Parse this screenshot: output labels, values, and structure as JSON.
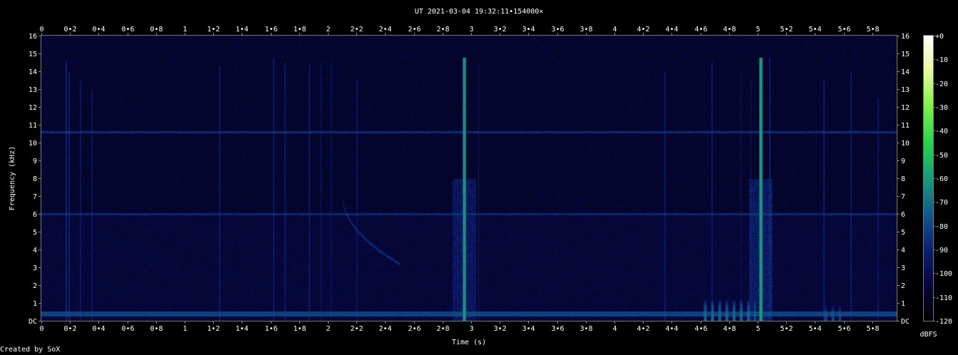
{
  "chart_data": {
    "type": "heatmap",
    "title": "UT 2021-03-04 19:32:11•154000×",
    "xlabel": "Time (s)",
    "ylabel": "Frequency (kHz)",
    "xlim": [
      0,
      5.97
    ],
    "ylim": [
      0,
      16
    ],
    "x_ticks": [
      "0",
      "0•2",
      "0•4",
      "0•6",
      "0•8",
      "1",
      "1•2",
      "1•4",
      "1•6",
      "1•8",
      "2",
      "2•2",
      "2•4",
      "2•6",
      "2•8",
      "3",
      "3•2",
      "3•4",
      "3•6",
      "3•8",
      "4",
      "4•2",
      "4•4",
      "4•6",
      "4•8",
      "5",
      "5•2",
      "5•4",
      "5•6",
      "5•8"
    ],
    "x_tick_values": [
      0,
      0.2,
      0.4,
      0.6,
      0.8,
      1,
      1.2,
      1.4,
      1.6,
      1.8,
      2,
      2.2,
      2.4,
      2.6,
      2.8,
      3,
      3.2,
      3.4,
      3.6,
      3.8,
      4,
      4.2,
      4.4,
      4.6,
      4.8,
      5,
      5.2,
      5.4,
      5.6,
      5.8
    ],
    "y_ticks": [
      "DC",
      "1",
      "2",
      "3",
      "4",
      "5",
      "6",
      "7",
      "8",
      "9",
      "10",
      "11",
      "12",
      "13",
      "14",
      "15",
      "16"
    ],
    "y_tick_values": [
      0,
      1,
      2,
      3,
      4,
      5,
      6,
      7,
      8,
      9,
      10,
      11,
      12,
      13,
      14,
      15,
      16
    ],
    "colorbar": {
      "label": "dBFS",
      "ticks": [
        "+0",
        "-10",
        "-20",
        "-30",
        "-40",
        "-50",
        "-60",
        "-70",
        "-80",
        "-90",
        "-100",
        "-110",
        "-120"
      ],
      "tick_values": [
        0,
        -10,
        -20,
        -30,
        -40,
        -50,
        -60,
        -70,
        -80,
        -90,
        -100,
        -110,
        -120
      ],
      "range": [
        -120,
        0
      ],
      "colors": [
        "#000000",
        "#06063a",
        "#0c1e6e",
        "#145a8c",
        "#1c9a7a",
        "#2ad24e",
        "#7ef04a",
        "#e8f8a0",
        "#ffffff"
      ]
    },
    "features": {
      "background_db": -108,
      "low_band": {
        "f_khz": [
          0.25,
          0.55
        ],
        "db": -82
      },
      "horizontal_lines": [
        {
          "f_khz": 10.6,
          "db": -88
        },
        {
          "f_khz": 6.0,
          "db": -90
        }
      ],
      "chirp": {
        "t_start": 2.1,
        "f_start": 7.0,
        "t_end": 2.5,
        "f_end": 3.2,
        "db": -90
      },
      "strong_pulses": [
        {
          "t": 2.95,
          "f_max": 14.8,
          "db": -62
        },
        {
          "t": 5.02,
          "f_max": 14.8,
          "db": -60
        }
      ],
      "pulses": [
        {
          "t": 0.17,
          "f_max": 14.6,
          "db": -90
        },
        {
          "t": 0.19,
          "f_max": 14.0,
          "db": -92
        },
        {
          "t": 0.27,
          "f_max": 13.5,
          "db": -96
        },
        {
          "t": 0.35,
          "f_max": 13.0,
          "db": -98
        },
        {
          "t": 1.24,
          "f_max": 14.3,
          "db": -94
        },
        {
          "t": 1.62,
          "f_max": 14.8,
          "db": -95
        },
        {
          "t": 1.7,
          "f_max": 14.5,
          "db": -95
        },
        {
          "t": 1.87,
          "f_max": 14.5,
          "db": -95
        },
        {
          "t": 1.95,
          "f_max": 14.5,
          "db": -93
        },
        {
          "t": 2.02,
          "f_max": 14.5,
          "db": -94
        },
        {
          "t": 2.2,
          "f_max": 13.5,
          "db": -98
        },
        {
          "t": 3.05,
          "f_max": 14.5,
          "db": -94
        },
        {
          "t": 4.35,
          "f_max": 14.0,
          "db": -95
        },
        {
          "t": 4.68,
          "f_max": 14.5,
          "db": -96
        },
        {
          "t": 4.88,
          "f_max": 14.0,
          "db": -96
        },
        {
          "t": 4.95,
          "f_max": 13.5,
          "db": -96
        },
        {
          "t": 5.08,
          "f_max": 14.8,
          "db": -92
        },
        {
          "t": 5.46,
          "f_max": 13.5,
          "db": -93
        },
        {
          "t": 5.65,
          "f_max": 14.0,
          "db": -95
        },
        {
          "t": 5.84,
          "f_max": 12.5,
          "db": -97
        }
      ],
      "burst_groups": [
        {
          "t_start": 4.62,
          "t_end": 4.98,
          "f_max": 1.2,
          "db": -70
        },
        {
          "t_start": 5.46,
          "t_end": 5.58,
          "f_max": 0.9,
          "db": -78
        }
      ]
    }
  },
  "footer": {
    "text": "Created by SoX"
  }
}
